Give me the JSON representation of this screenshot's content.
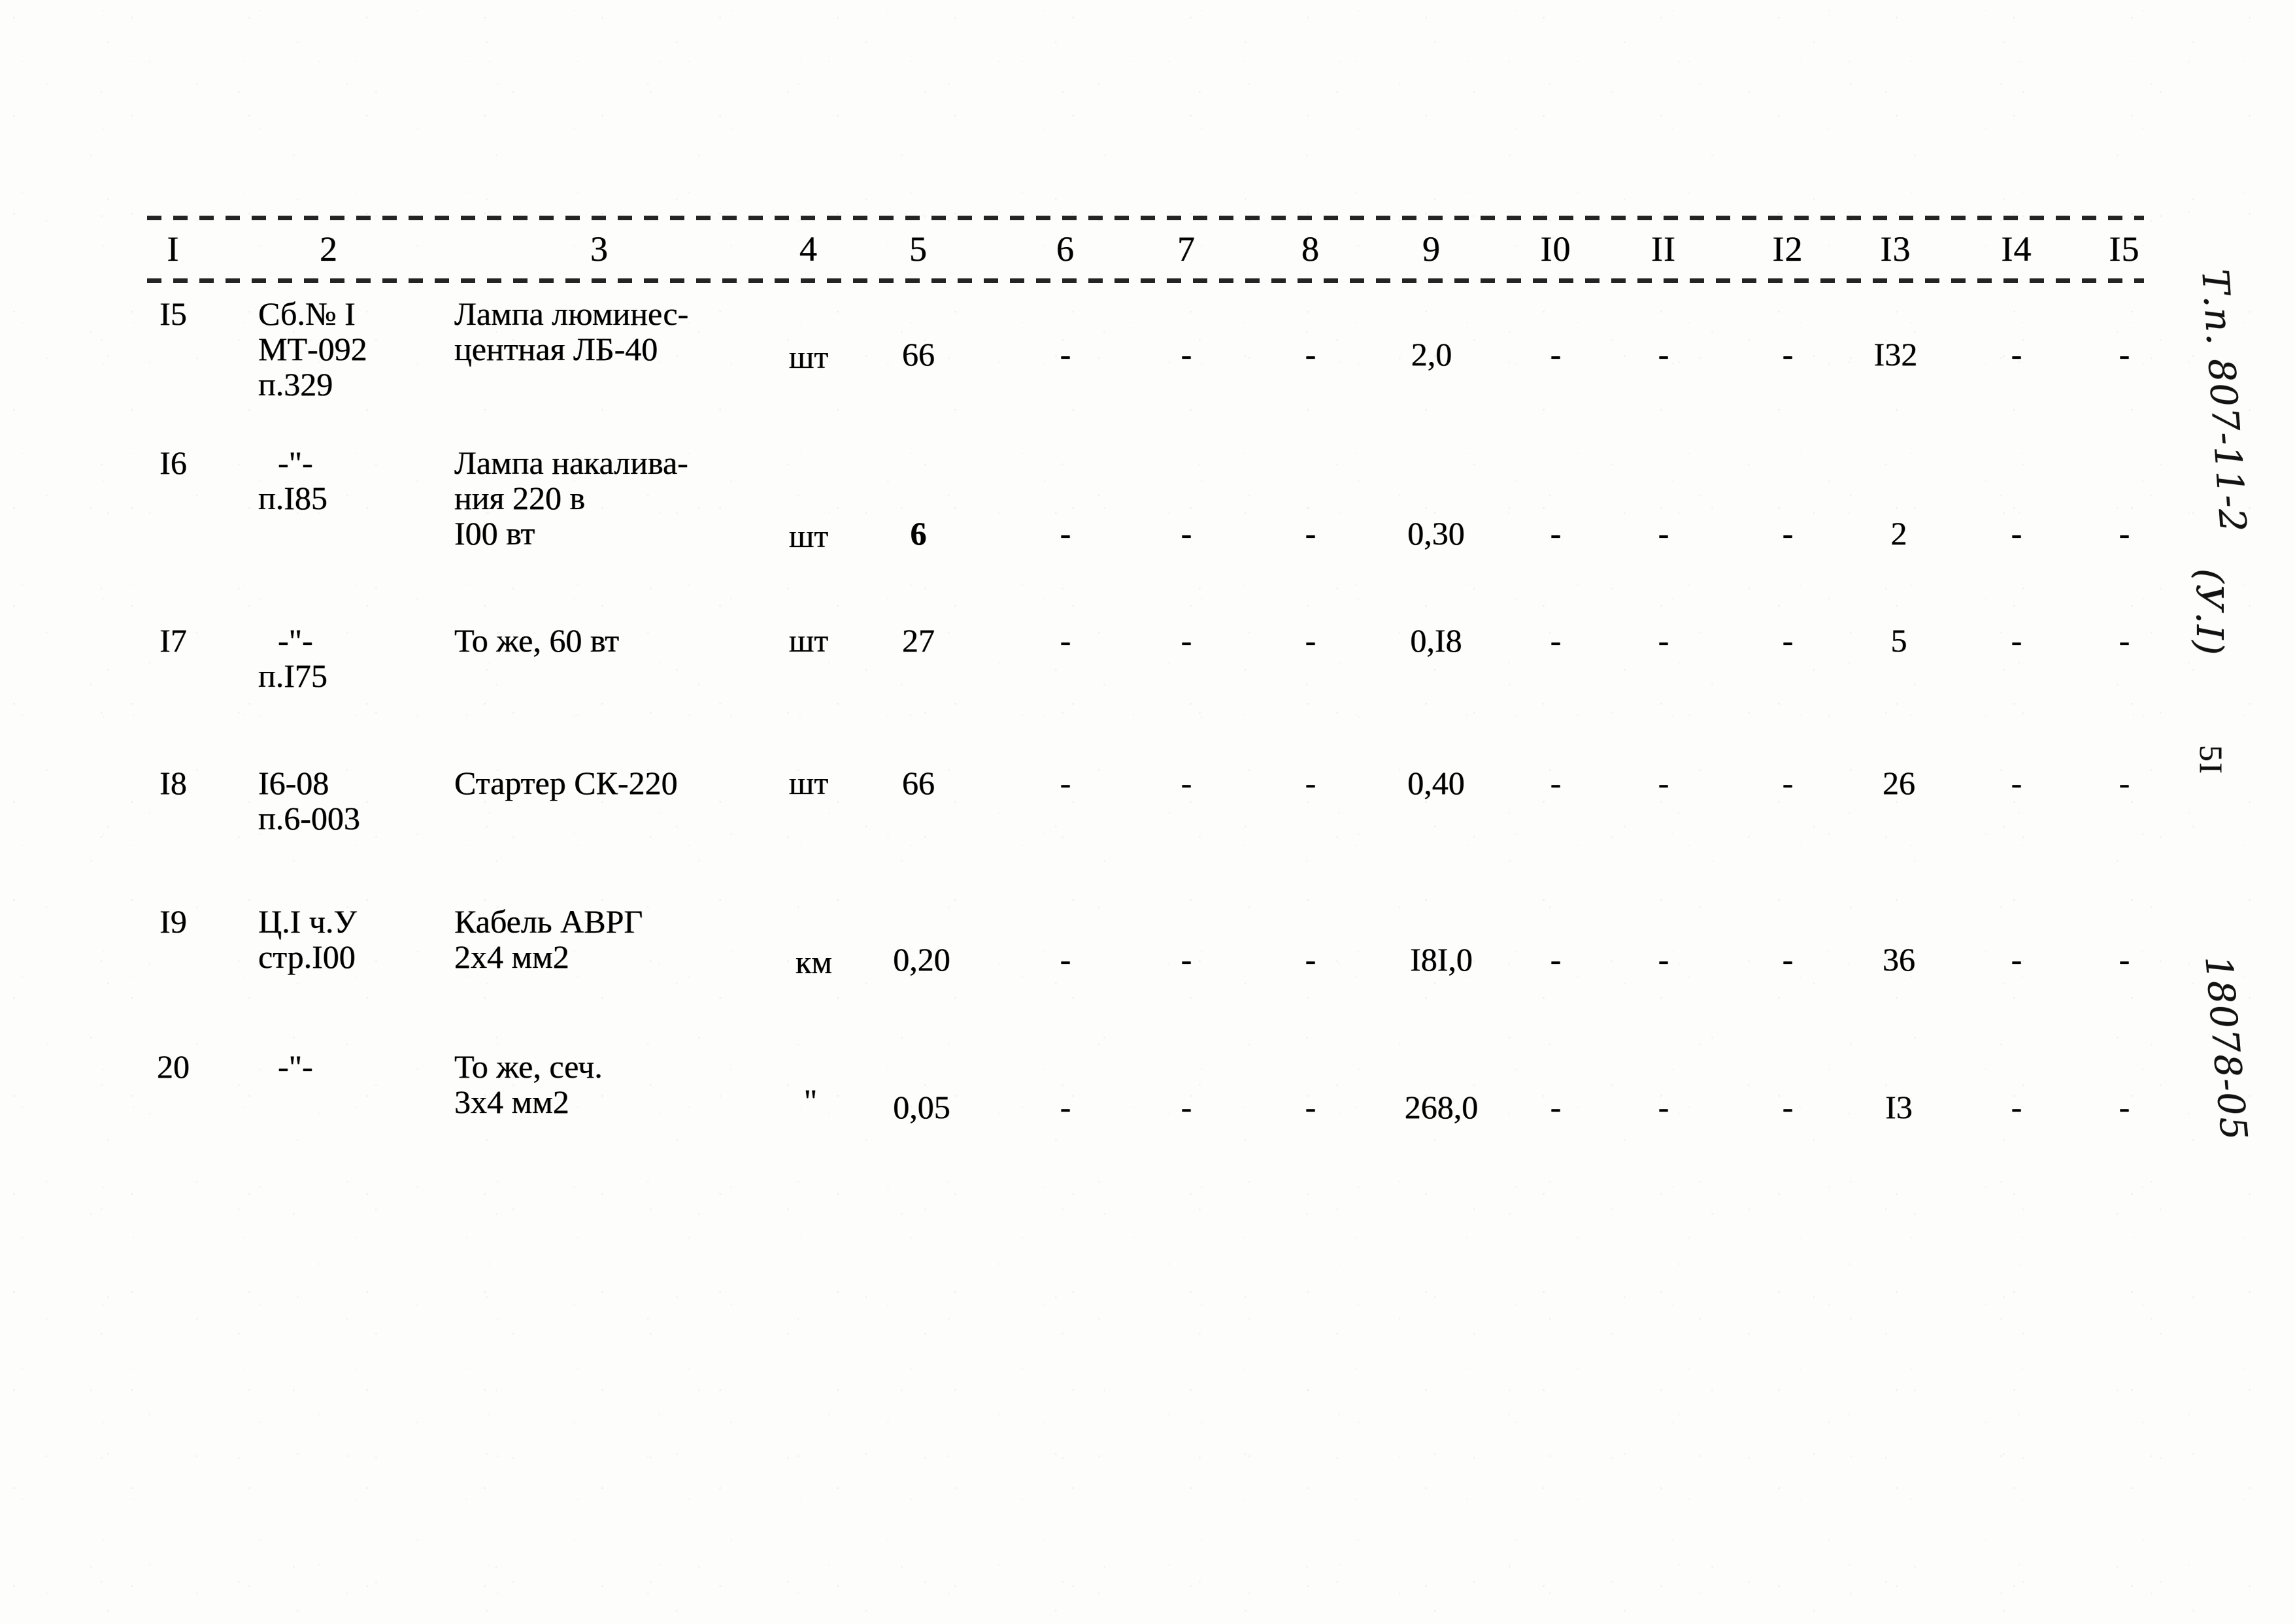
{
  "document": {
    "page_number": "5I",
    "stamp_project": "Т.п. 807-11-2",
    "stamp_part": "(У.I)",
    "stamp_archive": "18078-05"
  },
  "table": {
    "column_headers": [
      "I",
      "2",
      "3",
      "4",
      "5",
      "6",
      "7",
      "8",
      "9",
      "I0",
      "II",
      "I2",
      "I3",
      "I4",
      "I5"
    ],
    "rows": [
      {
        "num": "I5",
        "code": [
          "Сб.№ I",
          "МТ-092",
          "п.329"
        ],
        "name": [
          "Лампа люминес-",
          "центная ЛБ-40"
        ],
        "unit": "шт",
        "c5": "66",
        "c6": "-",
        "c7": "-",
        "c8": "-",
        "c9": "2,0",
        "c10": "-",
        "c11": "-",
        "c12": "-",
        "c13": "I32",
        "c14": "-",
        "c15": "-"
      },
      {
        "num": "I6",
        "code": [
          "-\"-",
          "п.I85"
        ],
        "name": [
          "Лампа накалива-",
          "ния 220 в",
          "I00 вт"
        ],
        "unit": "шт",
        "c5": "6",
        "c6": "-",
        "c7": "-",
        "c8": "-",
        "c9": "0,30",
        "c10": "-",
        "c11": "-",
        "c12": "-",
        "c13": "2",
        "c14": "-",
        "c15": "-"
      },
      {
        "num": "I7",
        "code": [
          "-\"-",
          "п.I75"
        ],
        "name": [
          "То же, 60 вт"
        ],
        "unit": "шт",
        "c5": "27",
        "c6": "-",
        "c7": "-",
        "c8": "-",
        "c9": "0,I8",
        "c10": "-",
        "c11": "-",
        "c12": "-",
        "c13": "5",
        "c14": "-",
        "c15": "-"
      },
      {
        "num": "I8",
        "code": [
          "I6-08",
          "п.6-003"
        ],
        "name": [
          "Стартер СК-220"
        ],
        "unit": "шт",
        "c5": "66",
        "c6": "-",
        "c7": "-",
        "c8": "-",
        "c9": "0,40",
        "c10": "-",
        "c11": "-",
        "c12": "-",
        "c13": "26",
        "c14": "-",
        "c15": "-"
      },
      {
        "num": "I9",
        "code": [
          "Ц.I ч.У",
          "стр.I00"
        ],
        "name": [
          "Кабель АВРГ",
          "2х4 мм2"
        ],
        "unit": "км",
        "c5": "0,20",
        "c6": "-",
        "c7": "-",
        "c8": "-",
        "c9": "I8I,0",
        "c10": "-",
        "c11": "-",
        "c12": "-",
        "c13": "36",
        "c14": "-",
        "c15": "-"
      },
      {
        "num": "20",
        "code": [
          "-\"-"
        ],
        "name": [
          "То же, сеч.",
          "3х4 мм2"
        ],
        "unit": "\"",
        "c5": "0,05",
        "c6": "-",
        "c7": "-",
        "c8": "-",
        "c9": "268,0",
        "c10": "-",
        "c11": "-",
        "c12": "-",
        "c13": "I3",
        "c14": "-",
        "c15": "-"
      }
    ]
  }
}
